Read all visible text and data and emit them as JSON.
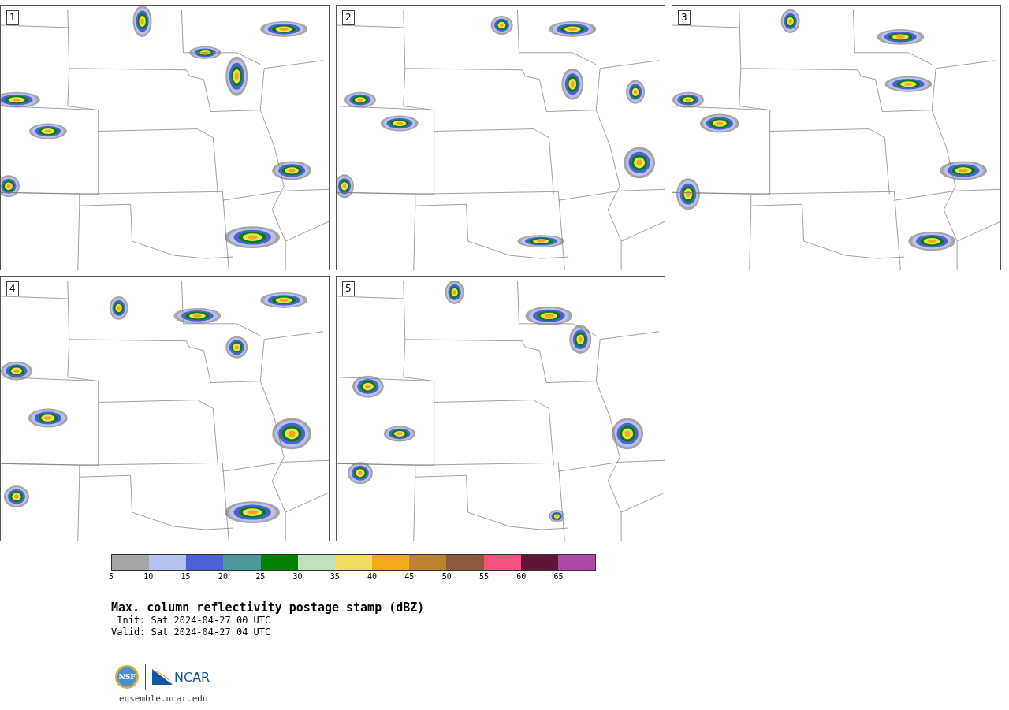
{
  "panels": [
    {
      "label": "1"
    },
    {
      "label": "2"
    },
    {
      "label": "3"
    },
    {
      "label": "4"
    },
    {
      "label": "5"
    }
  ],
  "colorbar": {
    "segments": [
      {
        "color": "#a5a5a5"
      },
      {
        "color": "#b7c3ee"
      },
      {
        "color": "#4f5fd6"
      },
      {
        "color": "#4f989a"
      },
      {
        "color": "#008200"
      },
      {
        "color": "#bfdfbf"
      },
      {
        "color": "#f0dc5e"
      },
      {
        "color": "#f0ab17"
      },
      {
        "color": "#bb8230"
      },
      {
        "color": "#8b5a3e"
      },
      {
        "color": "#f4517e"
      },
      {
        "color": "#5e1735"
      },
      {
        "color": "#ac4ba6"
      }
    ],
    "ticks": [
      "5",
      "10",
      "15",
      "20",
      "25",
      "30",
      "35",
      "40",
      "45",
      "50",
      "55",
      "60",
      "65"
    ]
  },
  "title": "Max. column reflectivity postage stamp (dBZ)",
  "init": " Init: Sat 2024-04-27 00 UTC",
  "valid": "Valid: Sat 2024-04-27 04 UTC",
  "logos": {
    "nsf": "NSF",
    "ncar": "NCAR"
  },
  "url": "ensemble.ucar.edu"
}
